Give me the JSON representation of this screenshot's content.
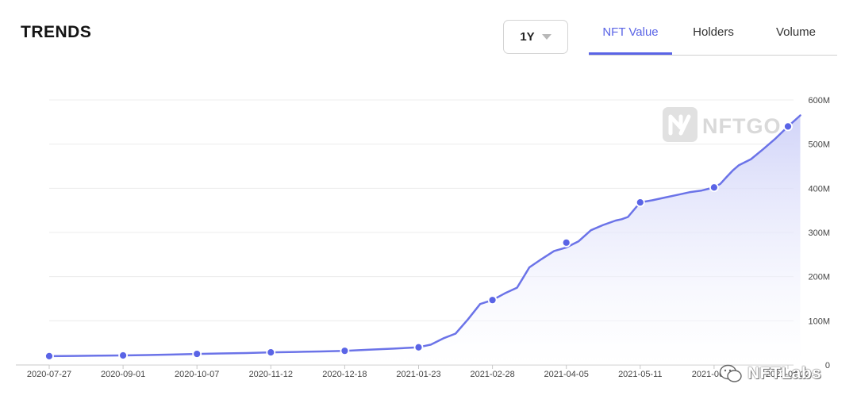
{
  "header": {
    "title": "TRENDS",
    "period": {
      "selected": "1Y"
    },
    "tabs": [
      {
        "label": "NFT Value",
        "active": true
      },
      {
        "label": "Holders",
        "active": false
      },
      {
        "label": "Volume",
        "active": false
      }
    ]
  },
  "colors": {
    "accent": "#5a64e6",
    "line": "#6b73e8",
    "fill_top": "#cfd2f8"
  },
  "watermark": {
    "text": "NFTGO"
  },
  "credit": {
    "text": "NFTLabs",
    "icon": "wechat-icon"
  },
  "chart_data": {
    "type": "area",
    "title": "",
    "xlabel": "",
    "ylabel": "",
    "ylim": [
      0,
      600000000
    ],
    "grid": true,
    "y_axis_position": "right",
    "y_ticks": [
      {
        "value": 600000000,
        "label": "600M"
      },
      {
        "value": 500000000,
        "label": "500M"
      },
      {
        "value": 400000000,
        "label": "400M"
      },
      {
        "value": 300000000,
        "label": "300M"
      },
      {
        "value": 200000000,
        "label": "200M"
      },
      {
        "value": 100000000,
        "label": "100M"
      },
      {
        "value": 0,
        "label": "0"
      }
    ],
    "x_ticks": [
      "2020-07-27",
      "2020-09-01",
      "2020-10-07",
      "2020-11-12",
      "2020-12-18",
      "2021-01-23",
      "2021-02-28",
      "2021-04-05",
      "2021-05-11",
      "2021-06-16",
      "2021-07-22"
    ],
    "series": [
      {
        "x": [
          "2020-07-27",
          "2020-08-08",
          "2020-08-20",
          "2020-09-01",
          "2020-09-13",
          "2020-09-25",
          "2020-10-07",
          "2020-10-19",
          "2020-10-31",
          "2020-11-12",
          "2020-11-24",
          "2020-12-06",
          "2020-12-18",
          "2020-12-30",
          "2021-01-11",
          "2021-01-23",
          "2021-01-29",
          "2021-02-04",
          "2021-02-10",
          "2021-02-16",
          "2021-02-22",
          "2021-02-28",
          "2021-03-06",
          "2021-03-12",
          "2021-03-15",
          "2021-03-18",
          "2021-03-24",
          "2021-03-30",
          "2021-04-05",
          "2021-04-11",
          "2021-04-17",
          "2021-04-23",
          "2021-04-29",
          "2021-05-02",
          "2021-05-05",
          "2021-05-11",
          "2021-05-17",
          "2021-05-23",
          "2021-05-29",
          "2021-06-04",
          "2021-06-10",
          "2021-06-16",
          "2021-06-19",
          "2021-06-22",
          "2021-06-25",
          "2021-06-28",
          "2021-07-04",
          "2021-07-10",
          "2021-07-16",
          "2021-07-22",
          "2021-07-28"
        ],
        "values": [
          20000000,
          20500000,
          21000000,
          21500000,
          22500000,
          23500000,
          25000000,
          26000000,
          27000000,
          28500000,
          29500000,
          30500000,
          32000000,
          34500000,
          37000000,
          40000000,
          46000000,
          60000000,
          71000000,
          103000000,
          138000000,
          147000000,
          162000000,
          175000000,
          198000000,
          221000000,
          240000000,
          258000000,
          266000000,
          280000000,
          305000000,
          317000000,
          327000000,
          330000000,
          335000000,
          368000000,
          373000000,
          379000000,
          385000000,
          391000000,
          395000000,
          402000000,
          410000000,
          425000000,
          440000000,
          452000000,
          466000000,
          489000000,
          513000000,
          540000000,
          565000000
        ]
      }
    ],
    "markers": [
      {
        "x": "2020-07-27",
        "y": 20000000
      },
      {
        "x": "2020-09-01",
        "y": 21500000
      },
      {
        "x": "2020-10-07",
        "y": 25000000
      },
      {
        "x": "2020-11-12",
        "y": 28500000
      },
      {
        "x": "2020-12-18",
        "y": 32000000
      },
      {
        "x": "2021-01-23",
        "y": 40000000
      },
      {
        "x": "2021-02-28",
        "y": 147000000
      },
      {
        "x": "2021-04-05",
        "y": 277000000
      },
      {
        "x": "2021-05-11",
        "y": 368000000
      },
      {
        "x": "2021-06-16",
        "y": 402000000
      },
      {
        "x": "2021-07-22",
        "y": 540000000
      }
    ]
  }
}
